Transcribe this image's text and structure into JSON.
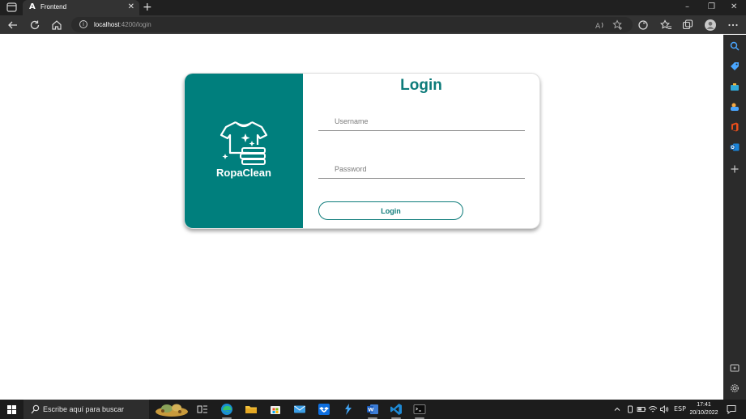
{
  "browser": {
    "tab_title": "Frontend",
    "tab_favicon": "A",
    "tab_close": "✕",
    "new_tab": "+",
    "url_host": "localhost",
    "url_path": ":4200/login",
    "window_controls": {
      "minimize": "–",
      "restore": "❐",
      "close": "✕"
    },
    "icons": [
      "back-icon",
      "refresh-icon",
      "home-icon",
      "site-info-icon",
      "read-aloud-icon",
      "add-favorite-icon",
      "extension-icon",
      "favorites-icon",
      "collections-icon",
      "profile-avatar-icon",
      "more-icon"
    ]
  },
  "sidebar": {
    "icons": [
      "search-icon",
      "shopping-tag-icon",
      "tools-icon",
      "games-icon",
      "office-icon",
      "outlook-icon",
      "add-icon",
      "screenshot-icon",
      "settings-icon"
    ]
  },
  "login": {
    "brand_name": "RopaClean",
    "brand_logo": "tshirt-laundry-logo",
    "title": "Login",
    "username_placeholder": "Username",
    "password_placeholder": "Password",
    "button_label": "Login",
    "colors": {
      "primary": "#007f7d",
      "title": "#0d7b7a",
      "button_border": "#0d7b7a"
    }
  },
  "taskbar": {
    "search_placeholder": "Escribe aquí para buscar",
    "apps": [
      "task-view-icon",
      "edge-icon",
      "file-explorer-icon",
      "store-icon",
      "mail-icon",
      "dropbox-icon",
      "visual-studio-icon",
      "word-icon",
      "vscode-icon",
      "terminal-icon"
    ],
    "tray": {
      "language": "ESP",
      "time": "17:41",
      "date": "20/10/2022"
    }
  }
}
